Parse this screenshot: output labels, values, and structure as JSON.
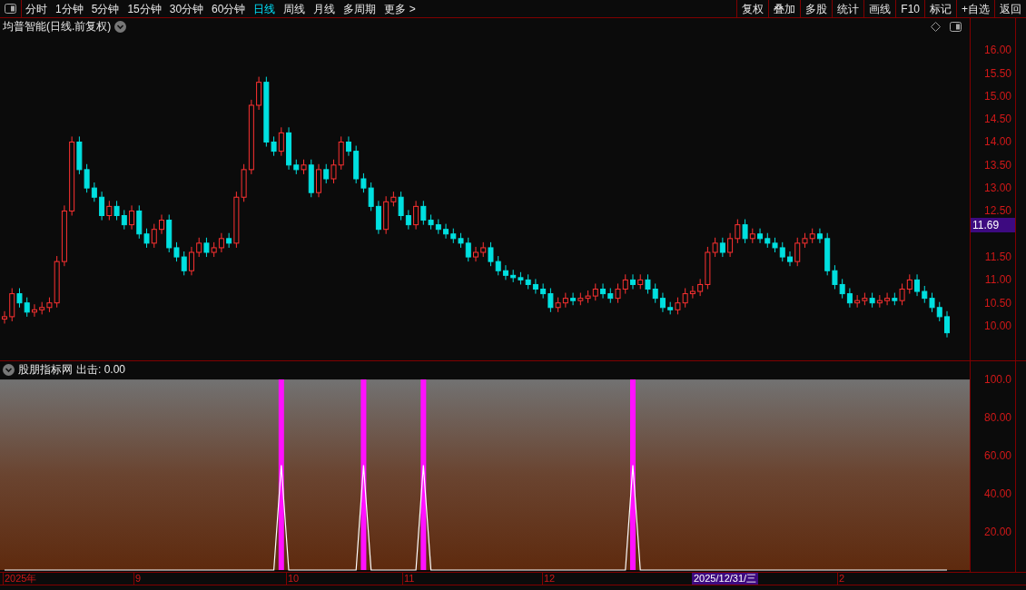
{
  "toolbar": {
    "tabs": [
      {
        "label": "分时",
        "selected": false
      },
      {
        "label": "1分钟",
        "selected": false
      },
      {
        "label": "5分钟",
        "selected": false
      },
      {
        "label": "15分钟",
        "selected": false
      },
      {
        "label": "30分钟",
        "selected": false
      },
      {
        "label": "60分钟",
        "selected": false
      },
      {
        "label": "日线",
        "selected": true
      },
      {
        "label": "周线",
        "selected": false
      },
      {
        "label": "月线",
        "selected": false
      },
      {
        "label": "多周期",
        "selected": false
      },
      {
        "label": "更多 >",
        "selected": false
      }
    ],
    "buttons": [
      "复权",
      "叠加",
      "多股",
      "统计",
      "画线",
      "F10",
      "标记",
      "+自选",
      "返回"
    ]
  },
  "price_panel": {
    "title": "均普智能(日线.前复权)",
    "price_axis": [
      "16.00",
      "15.50",
      "15.00",
      "14.50",
      "14.00",
      "13.50",
      "13.00",
      "12.50",
      "11.50",
      "11.00",
      "10.50",
      "10.00"
    ],
    "cursor_price": "11.69"
  },
  "indicator_panel": {
    "name": "股朋指标网",
    "reading": "出击: 0.00",
    "chart_data": {
      "type": "line",
      "ylim": [
        0,
        101
      ],
      "series": [
        {
          "color": "#ffffff",
          "values": [
            0,
            0,
            0,
            0,
            0,
            0,
            0,
            0,
            0,
            0,
            0,
            0,
            0,
            0,
            0,
            0,
            0,
            0,
            0,
            0,
            0,
            0,
            0,
            0,
            0,
            0,
            0,
            0,
            0,
            0,
            0,
            0,
            0,
            0,
            0,
            0,
            0,
            55,
            0,
            0,
            0,
            0,
            0,
            0,
            0,
            0,
            0,
            0,
            55,
            0,
            0,
            0,
            0,
            0,
            0,
            0,
            55,
            0,
            0,
            0,
            0,
            0,
            0,
            0,
            0,
            0,
            0,
            0,
            0,
            0,
            0,
            0,
            0,
            0,
            0,
            0,
            0,
            0,
            0,
            0,
            0,
            0,
            0,
            0,
            55,
            0,
            0,
            0,
            0,
            0,
            0,
            0,
            0,
            0,
            0,
            0,
            0,
            0,
            0,
            0,
            0,
            0,
            0,
            0,
            0,
            0,
            0,
            0,
            0,
            0,
            0,
            0,
            0,
            0,
            0,
            0,
            0,
            0,
            0,
            0,
            0,
            0,
            0,
            0,
            0,
            0,
            0
          ]
        }
      ],
      "yticks": [
        {
          "value": 100,
          "label": "100.0"
        },
        {
          "value": 80,
          "label": "80.00"
        },
        {
          "value": 60,
          "label": "60.00"
        },
        {
          "value": 40,
          "label": "40.00"
        },
        {
          "value": 20,
          "label": "20.00"
        }
      ]
    }
  },
  "date_axis": {
    "labels": [
      "2025年",
      "9",
      "10",
      "11",
      "12",
      "2"
    ],
    "cursor_date": "2025/12/31/三"
  }
}
